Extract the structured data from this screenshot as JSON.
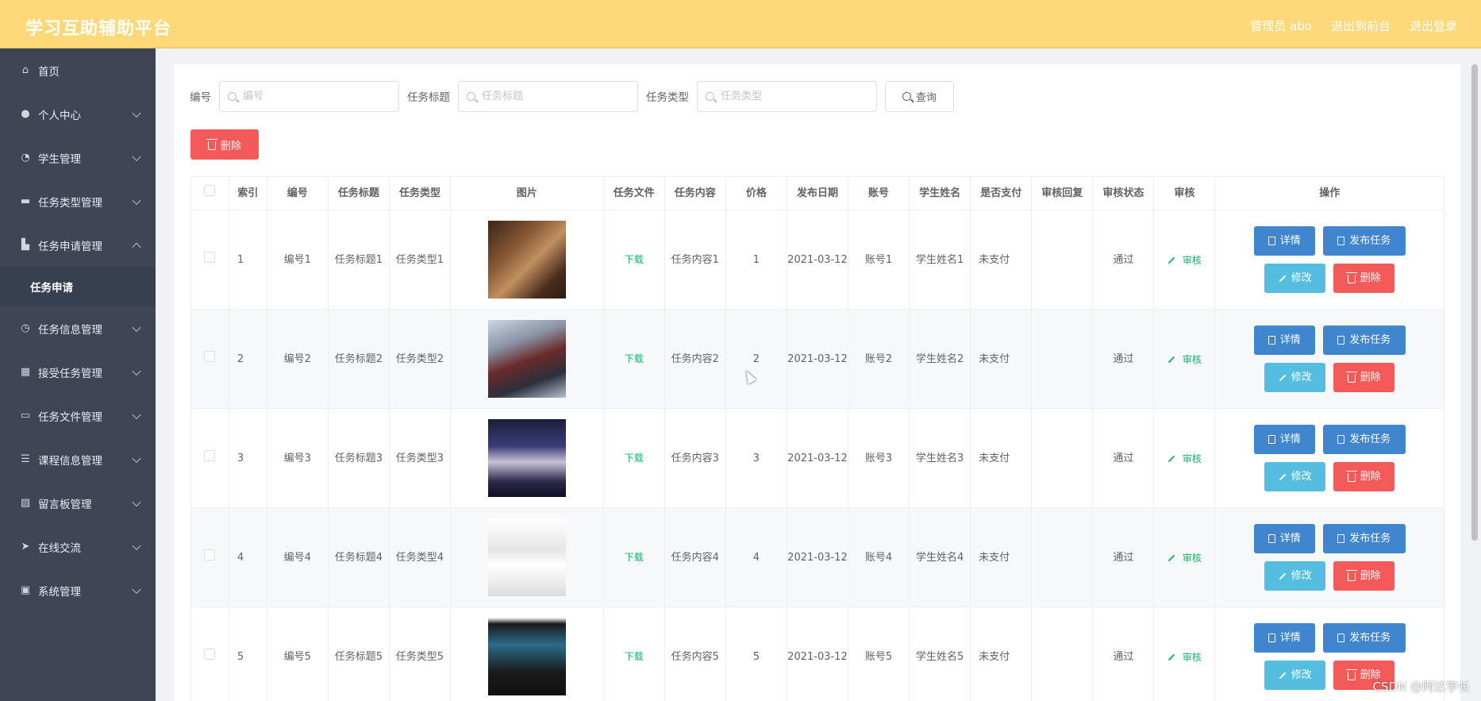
{
  "header": {
    "title": "学习互助辅助平台",
    "admin": "管理员 abo",
    "back_front": "退出到前台",
    "logout": "退出登录"
  },
  "sidebar": {
    "items": [
      {
        "label": "首页",
        "icon": "home-icon"
      },
      {
        "label": "个人中心",
        "icon": "user-icon"
      },
      {
        "label": "学生管理",
        "icon": "dashboard-icon"
      },
      {
        "label": "任务类型管理",
        "icon": "briefcase-icon"
      },
      {
        "label": "任务申请管理",
        "icon": "tasks-icon"
      },
      {
        "label": "任务申请",
        "icon": ""
      },
      {
        "label": "任务信息管理",
        "icon": "clock-icon"
      },
      {
        "label": "接受任务管理",
        "icon": "grid-icon"
      },
      {
        "label": "任务文件管理",
        "icon": "comment-icon"
      },
      {
        "label": "课程信息管理",
        "icon": "sliders-icon"
      },
      {
        "label": "留言板管理",
        "icon": "chart-icon"
      },
      {
        "label": "在线交流",
        "icon": "send-icon"
      },
      {
        "label": "系统管理",
        "icon": "clipboard-icon"
      }
    ]
  },
  "search": {
    "bianhao_label": "编号",
    "bianhao_placeholder": "编号",
    "title_label": "任务标题",
    "title_placeholder": "任务标题",
    "type_label": "任务类型",
    "type_placeholder": "任务类型",
    "query_label": "查询"
  },
  "toolbar": {
    "delete_label": "删除"
  },
  "table": {
    "headers": [
      "索引",
      "编号",
      "任务标题",
      "任务类型",
      "图片",
      "任务文件",
      "任务内容",
      "价格",
      "发布日期",
      "账号",
      "学生姓名",
      "是否支付",
      "审核回复",
      "审核状态",
      "审核",
      "操作"
    ],
    "rows": [
      {
        "index": "1",
        "bianhao": "编号1",
        "title": "任务标题1",
        "type": "任务类型1",
        "file": "下载",
        "content": "任务内容1",
        "price": "1",
        "date": "2021-03-12",
        "account": "账号1",
        "student": "学生姓名1",
        "paid": "未支付",
        "reply": "",
        "status": "通过",
        "audit": "审核"
      },
      {
        "index": "2",
        "bianhao": "编号2",
        "title": "任务标题2",
        "type": "任务类型2",
        "file": "下载",
        "content": "任务内容2",
        "price": "2",
        "date": "2021-03-12",
        "account": "账号2",
        "student": "学生姓名2",
        "paid": "未支付",
        "reply": "",
        "status": "通过",
        "audit": "审核"
      },
      {
        "index": "3",
        "bianhao": "编号3",
        "title": "任务标题3",
        "type": "任务类型3",
        "file": "下载",
        "content": "任务内容3",
        "price": "3",
        "date": "2021-03-12",
        "account": "账号3",
        "student": "学生姓名3",
        "paid": "未支付",
        "reply": "",
        "status": "通过",
        "audit": "审核"
      },
      {
        "index": "4",
        "bianhao": "编号4",
        "title": "任务标题4",
        "type": "任务类型4",
        "file": "下载",
        "content": "任务内容4",
        "price": "4",
        "date": "2021-03-12",
        "account": "账号4",
        "student": "学生姓名4",
        "paid": "未支付",
        "reply": "",
        "status": "通过",
        "audit": "审核"
      },
      {
        "index": "5",
        "bianhao": "编号5",
        "title": "任务标题5",
        "type": "任务类型5",
        "file": "下载",
        "content": "任务内容5",
        "price": "5",
        "date": "2021-03-12",
        "account": "账号5",
        "student": "学生姓名5",
        "paid": "未支付",
        "reply": "",
        "status": "通过",
        "audit": "审核"
      }
    ],
    "ops": {
      "detail": "详情",
      "publish": "发布任务",
      "edit": "修改",
      "delete": "删除"
    }
  },
  "watermark": "CSDN @阿达学长",
  "colors": {
    "header": "#ffd879",
    "sidebar": "#3e4656",
    "primary": "#3f86ce",
    "info": "#55bde0",
    "danger": "#f55a5a",
    "success": "#18b26b"
  }
}
